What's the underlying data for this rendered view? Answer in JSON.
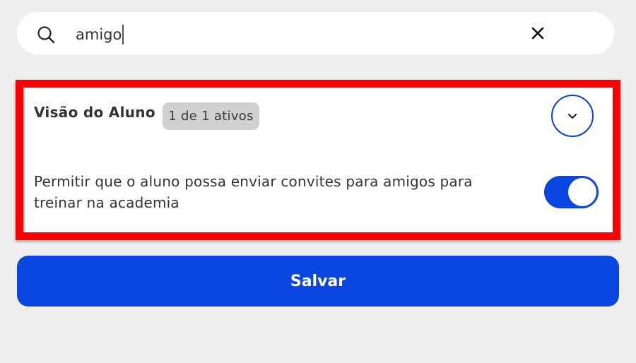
{
  "search": {
    "value": "amigo",
    "icon": "search-icon",
    "clear_icon": "close-icon"
  },
  "card": {
    "title": "Visão do Aluno",
    "badge": "1 de 1 ativos",
    "expand_icon": "chevron-down-icon",
    "setting": {
      "label": "Permitir que o aluno possa enviar convites para amigos para treinar na academia",
      "enabled": true
    }
  },
  "actions": {
    "save_label": "Salvar"
  },
  "colors": {
    "accent": "#0a47e0",
    "highlight": "#ff0000",
    "background": "#efefef"
  }
}
